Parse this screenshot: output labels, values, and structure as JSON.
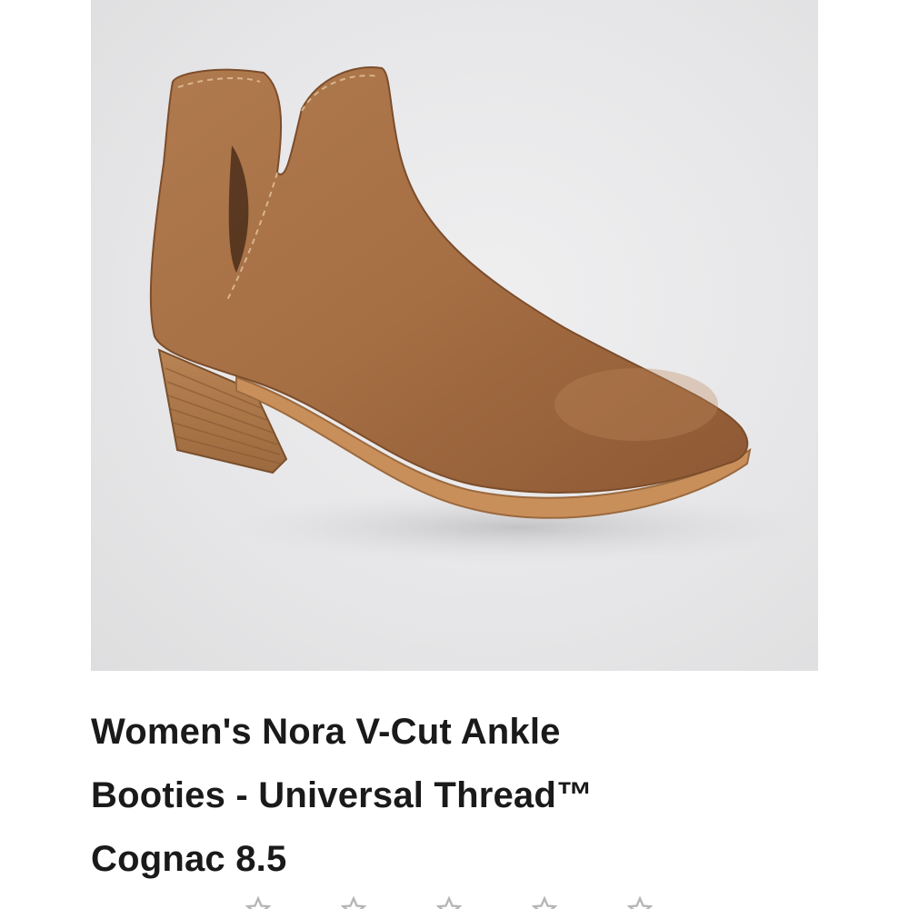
{
  "product": {
    "title_lines": [
      "Women's Nora V-Cut Ankle",
      "Booties - Universal Thread™",
      "Cognac 8.5"
    ],
    "image_icon": "ankle-bootie-photo",
    "image_color": "#a9744a",
    "background_color": "#e8e8ea"
  },
  "rating": {
    "star_icon": "star-icon",
    "star_count": 5,
    "star_color": "#b5b5b5"
  }
}
